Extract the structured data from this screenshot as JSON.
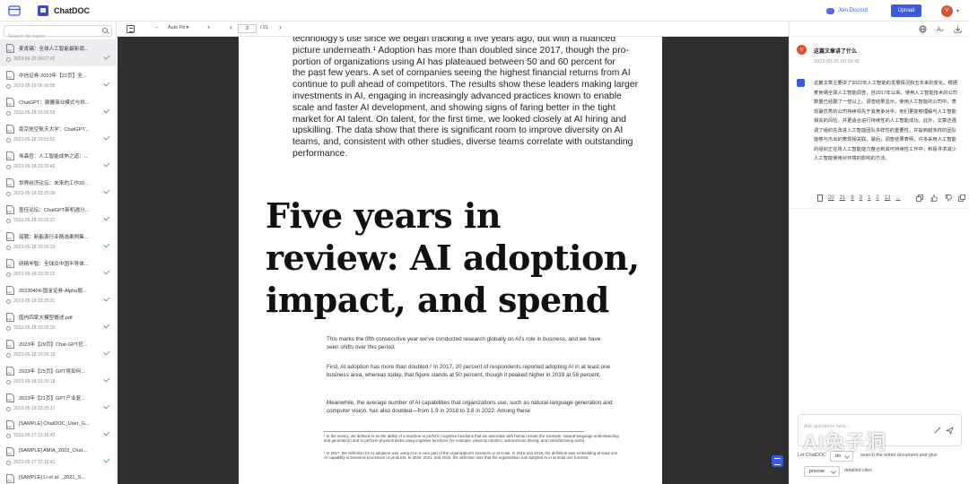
{
  "app": {
    "title": "ChatDOC"
  },
  "header": {
    "discord_label": "Join Discord",
    "upload_label": "Upload",
    "avatar_initial": "V"
  },
  "sidebar": {
    "search_placeholder": "Search file name",
    "files": [
      {
        "name": "麦肯锡：全球人工智能最新调...",
        "date": "2023-05-25 00:27:03",
        "active": true
      },
      {
        "name": "中信证券-2023年【22页】全...",
        "date": "2023-05-19 06:00:55"
      },
      {
        "name": "ChatGPT：颠覆商业模式与供...",
        "date": "2023-05-18 23:26:59"
      },
      {
        "name": "南京航空航天大学：ChatGPT...",
        "date": "2023-05-18 23:53:52"
      },
      {
        "name": "埃森哲：人工智能成熟之道：...",
        "date": "2023-05-18 23:25:42"
      },
      {
        "name": "世界经济论坛：未来的工作20...",
        "date": "2023-05-18 23:25:39"
      },
      {
        "name": "壹佳论坛：ChatGPT新机遇分...",
        "date": "2023-05-18 23:25:27"
      },
      {
        "name": "猎聘：新能源行业精选案例集...",
        "date": "2023-05-18 23:25:23"
      },
      {
        "name": "研精毕智：全球及中国半导体...",
        "date": "2023-05-18 23:25:22"
      },
      {
        "name": "20230404-国金证券-Alpha掘...",
        "date": "2023-05-18 23:25:21"
      },
      {
        "name": "国内四家大模型概述.pdf",
        "date": "2023-05-18 23:25:20"
      },
      {
        "name": "2023年【29页】Chat-GPT狂...",
        "date": "2023-05-18 23:25:19"
      },
      {
        "name": "2023年【25页】GPT将如何...",
        "date": "2023-05-18 23:25:18"
      },
      {
        "name": "2023年【21页】GPT产业复...",
        "date": "2023-05-18 23:25:17"
      },
      {
        "name": "[SAMPLE] ChatDOC_User_G...",
        "date": "2023-05-17 12:16:42"
      },
      {
        "name": "[SAMPLE] AMIA_2023_Chat...",
        "date": "2023-05-17 12:16:41"
      },
      {
        "name": "[SAMPLE] Li et al. _2021_S...",
        "date": ""
      }
    ]
  },
  "pdf_toolbar": {
    "minus": "−",
    "zoom": "Auto Fit",
    "plus": "+",
    "prev": "‹",
    "next": "›",
    "page": "2",
    "total": "/ 21"
  },
  "pdf_page": {
    "body_lines": [
      "technology's use since we began tracking it five years ago, but with a nuanced",
      "picture underneath.¹ Adoption has more than doubled since 2017, though the pro-",
      "portion of organizations using AI has plateaued between 50 and 60 percent for",
      "the past few years. A set of companies seeing the highest financial returns from AI",
      "continue to pull ahead of competitors. The results show these leaders making larger",
      "investments in AI, engaging in increasingly advanced practices known to enable",
      "scale and faster AI development, and showing signs of faring better in the tight",
      "market for AI talent. On talent, for the first time, we looked closely at AI hiring and",
      "upskilling. The data show that there is significant room to improve diversity on AI",
      "teams, and, consistent with other studies, diverse teams correlate with outstanding",
      "performance."
    ],
    "headline_lines": [
      "Five years in",
      "review: AI adoption,",
      "impact, and spend"
    ],
    "para1": "This marks the fifth consecutive year we've conducted research globally on AI's role in business, and we have seen shifts over this period.",
    "para2": "First, AI adoption has more than doubled.² In 2017, 20 percent of respondents reported adopting AI in at least one business area, whereas today, that figure stands at 50 percent, though it peaked higher in 2019 at 58 percent.",
    "para3": "Meanwhile, the average number of AI capabilities that organizations use, such as natural-language generation and computer vision, has also doubled—from 1.9 in 2018 to 3.8 in 2022. Among these",
    "footnote1": "¹ In the survey, we defined AI as the ability of a machine to perform cognitive functions that we associate with human minds (for example, natural-language understanding and generation) and to perform physical tasks using cognitive functions (for example, physical robotics, autonomous driving, and manufacturing work).",
    "footnote2": "² In 2017, the definition for AI adoption was using AI in a core part of the organization's business or at scale. In 2018 and 2019, the definition was embedding at least one AI capability in business processes or products. In 2020, 2021, and 2022, the definition was that the organization has adopted AI in at least one function."
  },
  "chat": {
    "question": "这篇文章讲了什么",
    "question_time": "2023-05-25 00:29:45",
    "answer": "这篇文章主要讲了2022年人工智能的发展情况和五年来的变化。根据麦肯锡全球人工智能调查，自2017年以来，使用人工智能技术的公司数量已经翻了一倍以上。调查结果显示，使用人工智能的公司中，表现最优秀的公司持续领先于其竞争对手，他们更能够理解与人工智能相关的风险，并更适合进行持续性的人工智能成功。此外，文章还强调了组织在改进人工智能团队多样性的重要性，并提到越多样的团队能够与杰出的表现相关联。最后，调查结果表明，许多采用人工智能的组织正在将人工智能能力整合到其可持续性工作中，积极寻求减少人工智能使用对环境的影响的方法。",
    "refs": [
      "20",
      "21",
      "8",
      "9",
      "1",
      "2",
      "13",
      "..."
    ],
    "current_ref": "2",
    "input_placeholder": "Ask questions here...",
    "mode_label": "Let ChatDOC",
    "mode_value": "do",
    "mode_desc": "search the entire document and give",
    "precise_value": "precise",
    "precise_desc": "detailed cites"
  },
  "watermark": "AI兔子洞",
  "colors": {
    "accent": "#3b5bdb",
    "avatar": "#d9542c",
    "check": "#4fae5a",
    "viewer_bg": "#2f2f2f"
  }
}
